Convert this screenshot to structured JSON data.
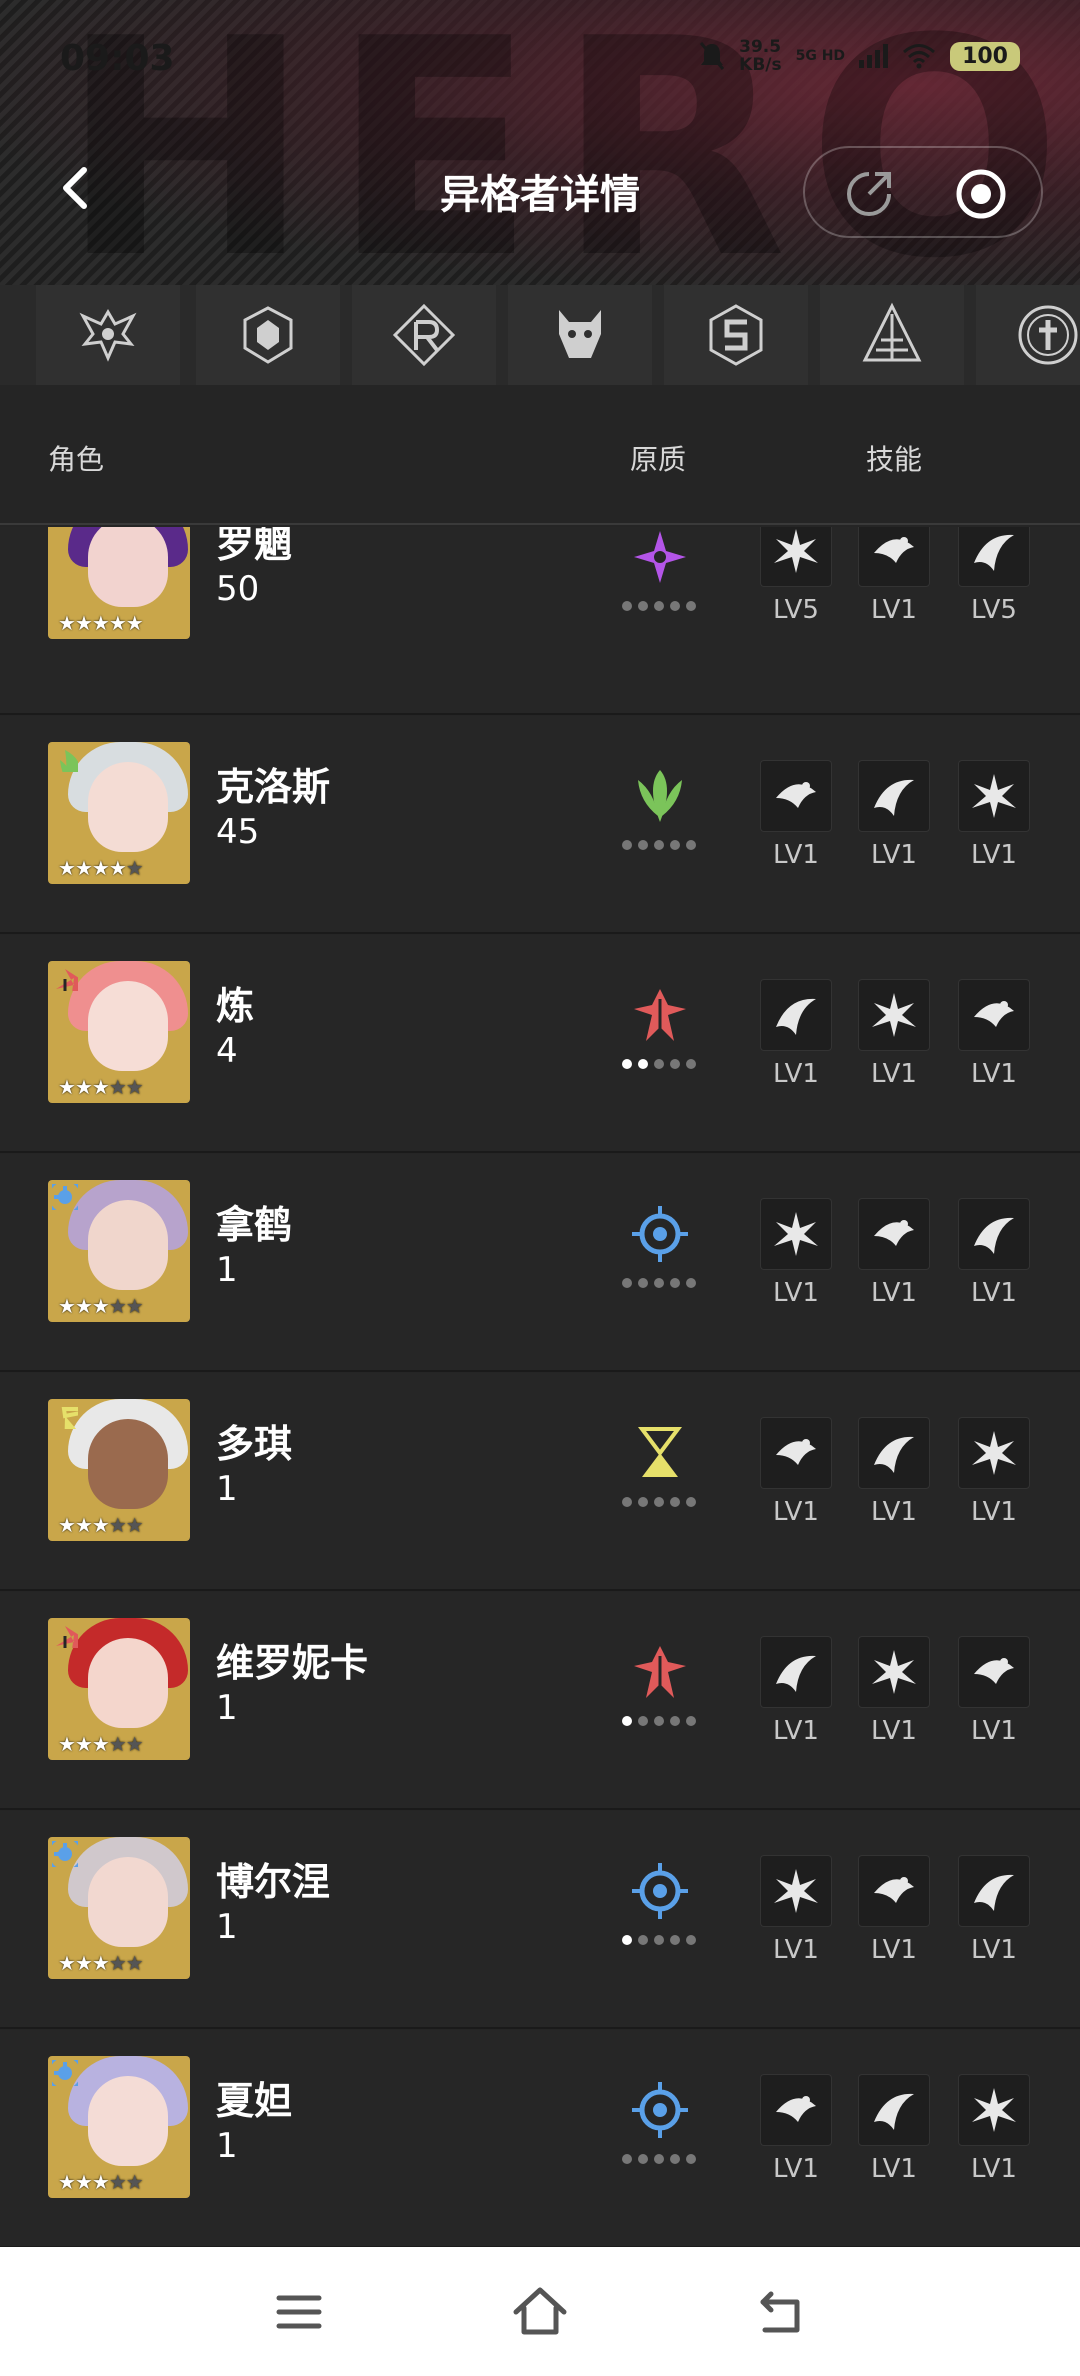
{
  "status_bar": {
    "time": "09:03",
    "speed_value": "39.5",
    "speed_unit": "KB/s",
    "network": "5G HD",
    "battery": "100"
  },
  "header": {
    "title": "异格者详情",
    "back_icon": "chevron-left-icon",
    "share_icon": "share-icon",
    "record_icon": "record-icon"
  },
  "factions": [
    {
      "icon": "winged-crest-icon"
    },
    {
      "icon": "hex-shield-icon"
    },
    {
      "icon": "r-diamond-icon"
    },
    {
      "icon": "beast-mask-icon"
    },
    {
      "icon": "s-hexagon-icon"
    },
    {
      "icon": "triangle-ladder-icon"
    },
    {
      "icon": "round-cross-icon"
    }
  ],
  "columns": {
    "role": "角色",
    "quality": "原质",
    "skill": "技能"
  },
  "characters": [
    {
      "name": "罗魍",
      "level": "50",
      "stars": 5,
      "attr_color": "#b455e8",
      "attr_icon": "purple-shuriken-icon",
      "dots_on": 0,
      "avatar_bg": "#c9a64a",
      "hair": "#5a2a8a",
      "face": "#f2d3cf",
      "skills": [
        {
          "lv": "LV5",
          "icon": "burst-icon"
        },
        {
          "lv": "LV1",
          "icon": "dash-icon"
        },
        {
          "lv": "LV5",
          "icon": "swirl-icon"
        }
      ]
    },
    {
      "name": "克洛斯",
      "level": "45",
      "stars": 4,
      "attr_color": "#7bc45a",
      "attr_icon": "green-leaf-icon",
      "dots_on": 0,
      "avatar_bg": "#c9a64a",
      "hair": "#d8dde0",
      "face": "#f4dcd4",
      "skills": [
        {
          "lv": "LV1",
          "icon": "spark-icon"
        },
        {
          "lv": "LV1",
          "icon": "eye-icon"
        },
        {
          "lv": "LV1",
          "icon": "sun-icon"
        }
      ]
    },
    {
      "name": "炼",
      "level": "4",
      "stars": 3,
      "attr_color": "#e05a5a",
      "attr_icon": "red-tower-icon",
      "dots_on": 2,
      "avatar_bg": "#c9a64a",
      "hair": "#ef8f8f",
      "face": "#f6ddd6",
      "skills": [
        {
          "lv": "LV1",
          "icon": "crescent-icon"
        },
        {
          "lv": "LV1",
          "icon": "wing-icon"
        },
        {
          "lv": "LV1",
          "icon": "flame-icon"
        }
      ]
    },
    {
      "name": "拿鹤",
      "level": "1",
      "stars": 3,
      "attr_color": "#5aa0e8",
      "attr_icon": "blue-gear-icon",
      "dots_on": 0,
      "avatar_bg": "#c9a64a",
      "hair": "#b7a3cc",
      "face": "#f0d6cc",
      "skills": [
        {
          "lv": "LV1",
          "icon": "wave-icon"
        },
        {
          "lv": "LV1",
          "icon": "vortex-icon"
        },
        {
          "lv": "LV1",
          "icon": "claw-icon"
        }
      ]
    },
    {
      "name": "多琪",
      "level": "1",
      "stars": 3,
      "attr_color": "#e6e06a",
      "attr_icon": "yellow-hourglass-icon",
      "dots_on": 0,
      "avatar_bg": "#c9a64a",
      "hair": "#e8e8e8",
      "face": "#9a6a4e",
      "skills": [
        {
          "lv": "LV1",
          "icon": "target-icon"
        },
        {
          "lv": "LV1",
          "icon": "hat-icon"
        },
        {
          "lv": "LV1",
          "icon": "ufo-icon"
        }
      ]
    },
    {
      "name": "维罗妮卡",
      "level": "1",
      "stars": 3,
      "attr_color": "#e05a5a",
      "attr_icon": "red-tower-icon",
      "dots_on": 1,
      "avatar_bg": "#c9a64a",
      "hair": "#c42a2a",
      "face": "#f4d6cc",
      "skills": [
        {
          "lv": "LV1",
          "icon": "shard-icon"
        },
        {
          "lv": "LV1",
          "icon": "ring-icon"
        },
        {
          "lv": "LV1",
          "icon": "anchor-icon"
        }
      ]
    },
    {
      "name": "博尔涅",
      "level": "1",
      "stars": 3,
      "attr_color": "#5aa0e8",
      "attr_icon": "blue-gear-icon",
      "dots_on": 1,
      "avatar_bg": "#c9a64a",
      "hair": "#d0c8cc",
      "face": "#f2d8d0",
      "skills": [
        {
          "lv": "LV1",
          "icon": "slash-icon"
        },
        {
          "lv": "LV1",
          "icon": "nova-icon"
        },
        {
          "lv": "LV1",
          "icon": "figure-icon"
        }
      ]
    },
    {
      "name": "夏妲",
      "level": "1",
      "stars": 3,
      "attr_color": "#5aa0e8",
      "attr_icon": "blue-gear-icon",
      "dots_on": 0,
      "avatar_bg": "#c9a64a",
      "hair": "#b8b2e0",
      "face": "#f4dcd6",
      "skills": [
        {
          "lv": "LV1",
          "icon": "fireball-icon"
        },
        {
          "lv": "LV1",
          "icon": "torch-icon"
        },
        {
          "lv": "LV1",
          "icon": "fox-icon"
        }
      ]
    }
  ],
  "bottom_nav": {
    "menu_icon": "menu-icon",
    "home_icon": "home-icon",
    "back_icon": "back-arrow-icon"
  }
}
